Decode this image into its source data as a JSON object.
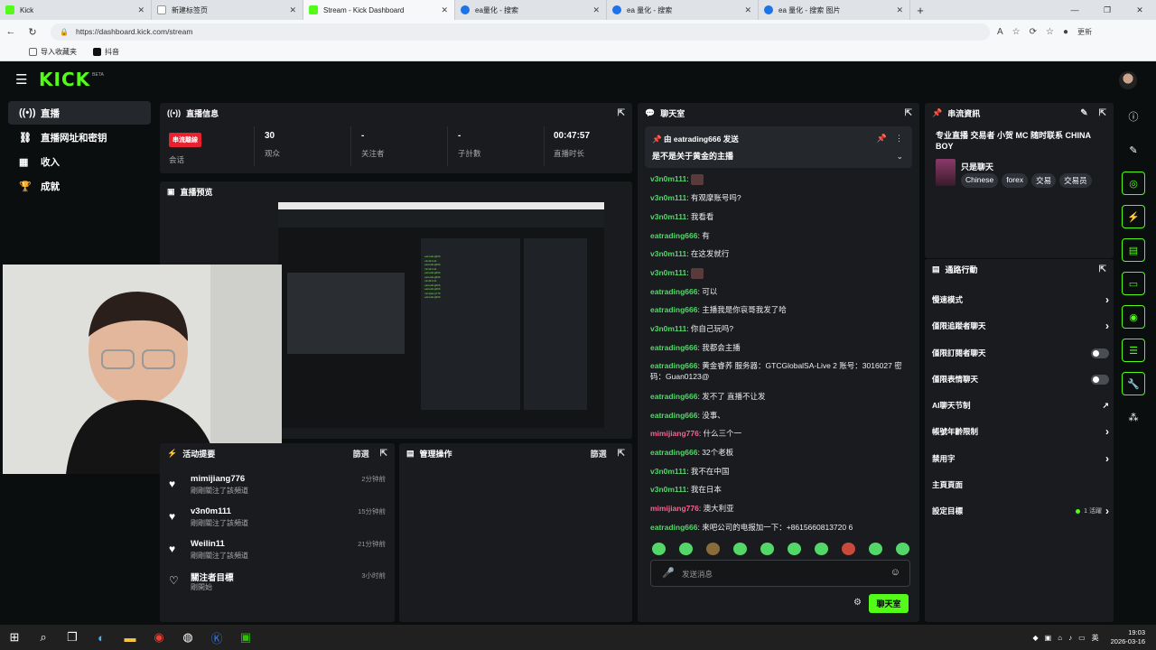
{
  "browser": {
    "tabs": [
      {
        "title": "Kick",
        "icon": "kick-icon"
      },
      {
        "title": "新建标签页",
        "icon": "page-icon"
      },
      {
        "title": "Stream - Kick Dashboard",
        "icon": "kick-icon"
      },
      {
        "title": "ea量化 - 搜索",
        "icon": "search-icon"
      },
      {
        "title": "ea 量化 - 搜索",
        "icon": "search-icon"
      },
      {
        "title": "ea 量化 - 搜索 图片",
        "icon": "search-icon"
      }
    ],
    "url": "https://dashboard.kick.com/stream",
    "bookmarks": [
      "导入收藏夹",
      "抖音"
    ],
    "profile_label": "更新"
  },
  "app": {
    "logo": "KICK",
    "logo_beta": "BETA"
  },
  "sidebar": {
    "items": [
      {
        "label": "直播",
        "icon": "broadcast-icon"
      },
      {
        "label": "直播网址和密钥",
        "icon": "link-icon"
      },
      {
        "label": "收入",
        "icon": "chart-icon"
      },
      {
        "label": "成就",
        "icon": "trophy-icon"
      }
    ]
  },
  "stream_info_panel": {
    "title": "直播信息",
    "stats": [
      {
        "value": "串流離線",
        "label": "会话"
      },
      {
        "value": "30",
        "label": "观众"
      },
      {
        "value": "-",
        "label": "关注者"
      },
      {
        "value": "-",
        "label": "子計數"
      },
      {
        "value": "00:47:57",
        "label": "直播时长"
      }
    ]
  },
  "preview_panel": {
    "title": "直播预览"
  },
  "activity_panel": {
    "title": "活动提要",
    "filter_label": "篩選",
    "items": [
      {
        "name": "mimijiang776",
        "sub": "剛剛關注了該頻道",
        "time": "2分钟前"
      },
      {
        "name": "v3n0m111",
        "sub": "剛剛關注了該頻道",
        "time": "15分钟前"
      },
      {
        "name": "Weilin11",
        "sub": "剛剛關注了該頻道",
        "time": "21分钟前"
      },
      {
        "name": "關注者目標",
        "sub": "剛開始",
        "time": "3小时前"
      }
    ]
  },
  "mod_panel": {
    "title": "管理操作",
    "filter_label": "篩選"
  },
  "chat_panel": {
    "title": "聊天室",
    "pinned": {
      "by_prefix": "由",
      "user": "eatrading666",
      "by_suffix": "发送",
      "text": "是不是关于黄金的主播"
    },
    "messages": [
      {
        "user": "v3n0m111",
        "text": "",
        "emote": true
      },
      {
        "user": "v3n0m111",
        "text": "有观摩账号吗?"
      },
      {
        "user": "v3n0m111",
        "text": "我看看"
      },
      {
        "user": "eatrading666",
        "text": "有"
      },
      {
        "user": "v3n0m111",
        "text": "在这发就行"
      },
      {
        "user": "v3n0m111",
        "text": "",
        "emote": true
      },
      {
        "user": "eatrading666",
        "text": "可以"
      },
      {
        "user": "eatrading666",
        "text": "主播我是你哀哥我发了哈"
      },
      {
        "user": "v3n0m111",
        "text": "你自己玩吗?"
      },
      {
        "user": "eatrading666",
        "text": "我都会主播"
      },
      {
        "user": "eatrading666",
        "text": "黄金睿荞 服务器：GTCGlobalSA-Live 2 账号：3016027 密码：Guan0123@"
      },
      {
        "user": "eatrading666",
        "text": "发不了 直播不让发"
      },
      {
        "user": "eatrading666",
        "text": "没事、"
      },
      {
        "user": "mimijiang776",
        "text": "什么三个一",
        "pink": true
      },
      {
        "user": "eatrading666",
        "text": "32个老板"
      },
      {
        "user": "v3n0m111",
        "text": "我不在中国"
      },
      {
        "user": "v3n0m111",
        "text": "我在日本"
      },
      {
        "user": "mimijiang776",
        "text": "澳大利亚",
        "pink": true
      },
      {
        "user": "eatrading666",
        "text": "来吧公司的电报加一下：+8615660813720 6"
      }
    ],
    "input_placeholder": "发送消息",
    "send_label": "聊天室"
  },
  "stream_details_panel": {
    "title": "串流資訊",
    "stream_title": "专业直播 交易者 小贺 MC 随时联系 CHINA BOY",
    "category": "只是聊天",
    "tags": [
      "Chinese",
      "forex",
      "交易",
      "交易员"
    ]
  },
  "quick_actions_panel": {
    "title": "通路行動",
    "rows": [
      {
        "label": "慢速模式",
        "control": "chevron"
      },
      {
        "label": "僅限追蹤者聊天",
        "control": "chevron"
      },
      {
        "label": "僅限訂閱者聊天",
        "control": "toggle"
      },
      {
        "label": "僅限表情聊天",
        "control": "toggle"
      },
      {
        "label": "AI聊天节制",
        "control": "external"
      },
      {
        "label": "帳號年齡限制",
        "control": "chevron"
      },
      {
        "label": "禁用字",
        "control": "chevron"
      },
      {
        "label": "主頁頁面",
        "control": "none"
      },
      {
        "label": "設定目標",
        "control": "goal",
        "extra": "1 活躍"
      }
    ]
  },
  "taskbar": {
    "time": "19:03",
    "date": "2026-03-16",
    "lang": "英"
  },
  "colors": {
    "accent": "#53fc18",
    "live_red": "#e8202f",
    "panel": "#191b1f"
  }
}
